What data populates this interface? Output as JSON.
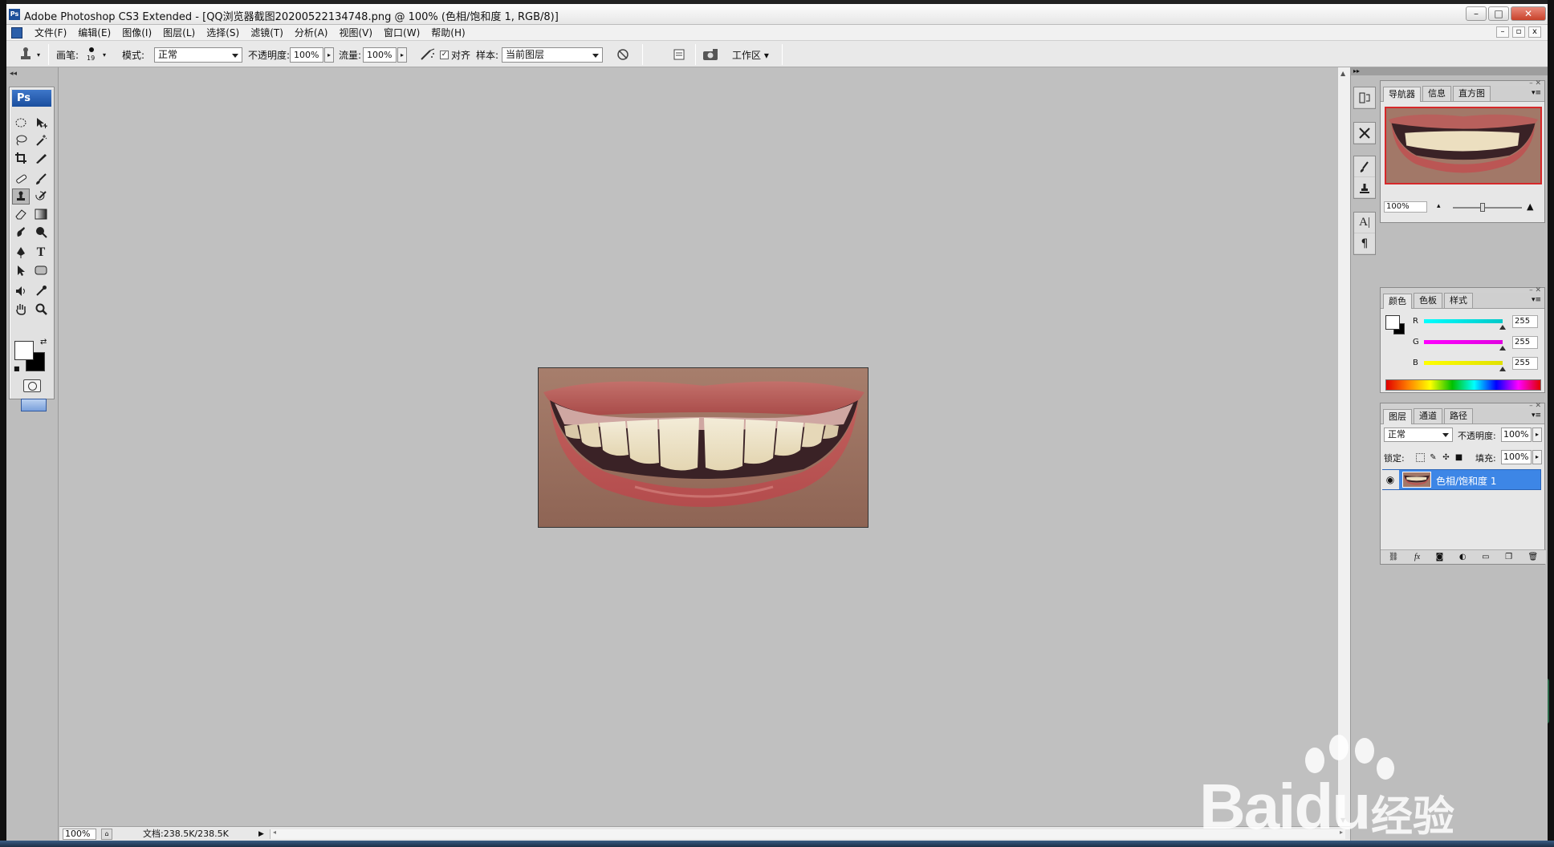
{
  "window": {
    "title": "Adobe Photoshop CS3 Extended - [QQ浏览器截图20200522134748.png @ 100% (色相/饱和度 1, RGB/8)]",
    "app_badge": "Ps",
    "min": "–",
    "max": "□",
    "close": "✕"
  },
  "menu": {
    "items": [
      "文件(F)",
      "编辑(E)",
      "图像(I)",
      "图层(L)",
      "选择(S)",
      "滤镜(T)",
      "分析(A)",
      "视图(V)",
      "窗口(W)",
      "帮助(H)"
    ],
    "mdi_min": "–",
    "mdi_restore": "▫",
    "mdi_close": "x"
  },
  "options": {
    "brush_label": "画笔:",
    "brush_size": "19",
    "mode_label": "模式:",
    "mode_value": "正常",
    "opacity_label": "不透明度:",
    "opacity_value": "100%",
    "flow_label": "流量:",
    "flow_value": "100%",
    "align_label": "对齐",
    "align_checked": "✓",
    "sample_label": "样本:",
    "sample_value": "当前图层",
    "workspace_label": "工作区 ▾"
  },
  "toolbox": {
    "title": "Ps",
    "active_tool": "clone-stamp-tool"
  },
  "status": {
    "zoom": "100%",
    "doc_size": "文档:238.5K/238.5K"
  },
  "navigator": {
    "tabs": [
      "导航器",
      "信息",
      "直方图"
    ],
    "zoom": "100%"
  },
  "color_panel": {
    "tabs": [
      "颜色",
      "色板",
      "样式"
    ],
    "channels": [
      {
        "label": "R",
        "value": "255",
        "gradient": "#00e0e0"
      },
      {
        "label": "G",
        "value": "255",
        "gradient": "#ff00ff"
      },
      {
        "label": "B",
        "value": "255",
        "gradient": "#ffff00"
      }
    ]
  },
  "layers_panel": {
    "tabs": [
      "图层",
      "通道",
      "路径"
    ],
    "blend_mode": "正常",
    "opacity_label": "不透明度:",
    "opacity_value": "100%",
    "lock_label": "锁定:",
    "fill_label": "填充:",
    "fill_value": "100%",
    "layers": [
      {
        "name": "色相/饱和度 1",
        "visible": true,
        "selected": true
      }
    ]
  },
  "colors": {
    "selection_blue": "#3d86e6",
    "workspace_gray": "#c0c0c0"
  }
}
